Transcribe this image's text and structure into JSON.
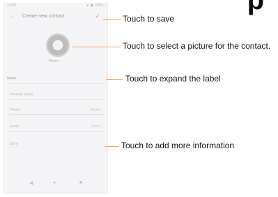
{
  "heading_fragment": "p",
  "phone": {
    "status_bar": {
      "left": "12:00",
      "right": "▲ ◼ 100%"
    },
    "app_bar": {
      "back_icon": "back-arrow-icon",
      "title": "Create new contact",
      "save_icon": "save-check-icon"
    },
    "avatar_label": "Phone",
    "fields": [
      {
        "label": "Name",
        "sublabel": ""
      },
      {
        "label": "Phonetic name",
        "sublabel": ""
      },
      {
        "label": "Phone",
        "sublabel": "Mobile"
      },
      {
        "label": "Email",
        "sublabel": "Home"
      },
      {
        "label": "More",
        "sublabel": ""
      }
    ],
    "nav": {
      "back": "◀",
      "home": "●",
      "recents": "■"
    }
  },
  "callouts": [
    {
      "text": "Touch to save"
    },
    {
      "text": "Touch to select a picture for the contact."
    },
    {
      "text": "Touch to expand the label"
    },
    {
      "text": "Touch to add more information"
    }
  ],
  "colors": {
    "callout_line": "#f5a05a"
  }
}
